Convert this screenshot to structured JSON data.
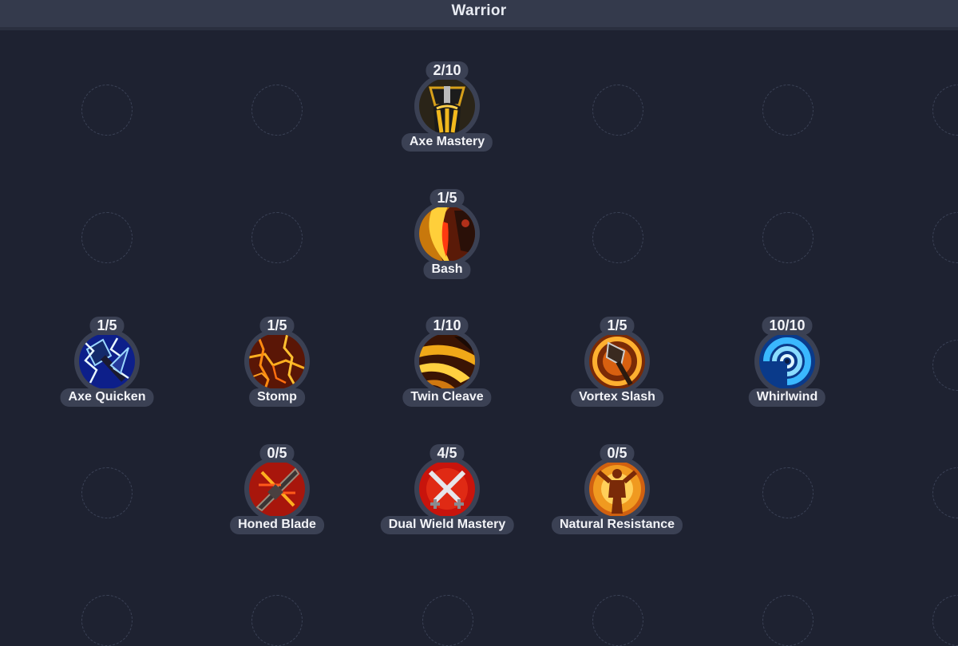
{
  "header": {
    "title": "Warrior"
  },
  "skills": [
    {
      "name": "Axe Mastery",
      "level": "2/10",
      "icon": "axe-mastery-icon",
      "color": "#c48a10"
    },
    {
      "name": "Bash",
      "level": "1/5",
      "icon": "bash-icon",
      "color": "#e0a020"
    },
    {
      "name": "Axe Quicken",
      "level": "1/5",
      "icon": "axe-quicken-icon",
      "color": "#1a3fb5"
    },
    {
      "name": "Stomp",
      "level": "1/5",
      "icon": "stomp-icon",
      "color": "#b83a0c"
    },
    {
      "name": "Twin Cleave",
      "level": "1/10",
      "icon": "twin-cleave-icon",
      "color": "#e09a10"
    },
    {
      "name": "Vortex Slash",
      "level": "1/5",
      "icon": "vortex-slash-icon",
      "color": "#d66a10"
    },
    {
      "name": "Whirlwind",
      "level": "10/10",
      "icon": "whirlwind-icon",
      "color": "#1e8ee0"
    },
    {
      "name": "Honed Blade",
      "level": "0/5",
      "icon": "honed-blade-icon",
      "color": "#c42010"
    },
    {
      "name": "Dual Wield Mastery",
      "level": "4/5",
      "icon": "dual-wield-mastery-icon",
      "color": "#d22018"
    },
    {
      "name": "Natural Resistance",
      "level": "0/5",
      "icon": "natural-resistance-icon",
      "color": "#e07a10"
    }
  ]
}
